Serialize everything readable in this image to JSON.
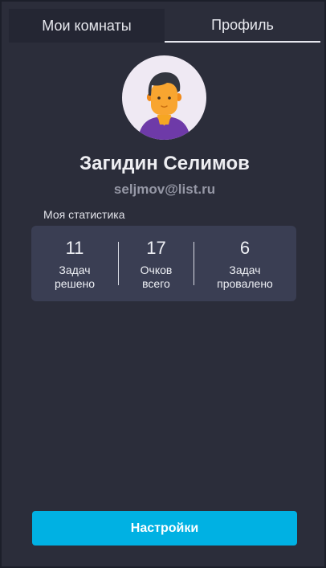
{
  "tabs": [
    {
      "label": "Мои комнаты",
      "active": false
    },
    {
      "label": "Профиль",
      "active": true
    }
  ],
  "profile": {
    "name": "Загидин Селимов",
    "email": "seljmov@list.ru",
    "avatar_icon": "user-avatar-icon"
  },
  "stats": {
    "title": "Моя статистика",
    "items": [
      {
        "value": "11",
        "label": "Задач\nрешено"
      },
      {
        "value": "17",
        "label": "Очков\nвсего"
      },
      {
        "value": "6",
        "label": "Задач\nпровалено"
      }
    ]
  },
  "settings_button": {
    "label": "Настройки"
  },
  "colors": {
    "background": "#2b2d3a",
    "card": "#3a3e53",
    "accent": "#00b1e3",
    "email": "#9698a6"
  }
}
